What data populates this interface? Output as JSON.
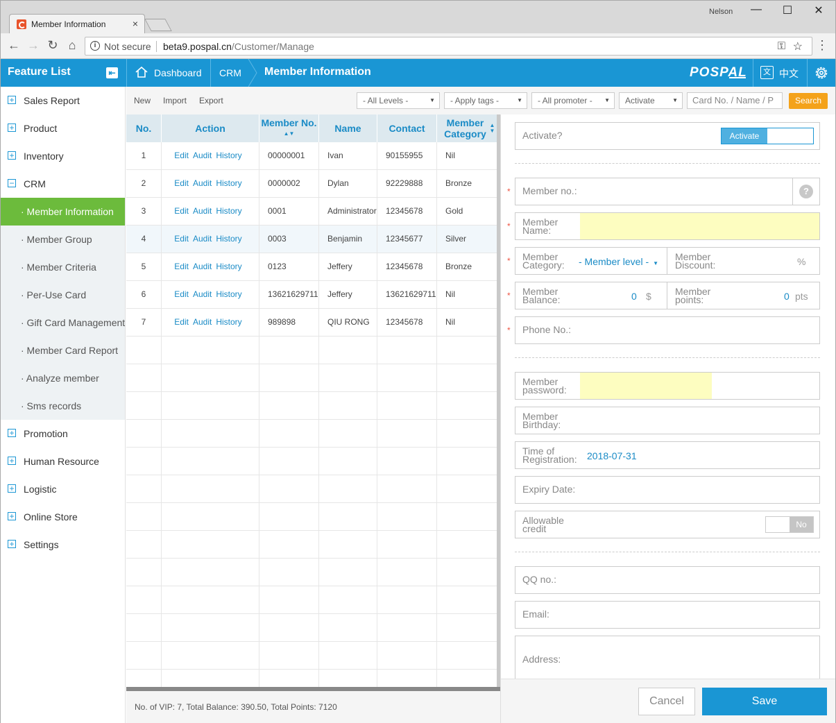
{
  "browser": {
    "tab_title": "Member Information",
    "tab_close": "×",
    "user": "Nelson",
    "win_min": "—",
    "win_max": "☐",
    "win_close": "✕",
    "back": "←",
    "forward": "→",
    "reload": "↻",
    "home": "⌂",
    "security": "Not secure",
    "url_host": "beta9.pospal.cn",
    "url_path": "/Customer/Manage",
    "key": "⚿",
    "star": "☆",
    "menu": "⋮"
  },
  "header": {
    "feature_list": "Feature List",
    "collapse": "⇤",
    "breadcrumb": [
      "Dashboard",
      "CRM"
    ],
    "current": "Member Information",
    "brand": "POSPAL",
    "lang_icon": "文",
    "lang_label": "中文",
    "accent": "#1a96d4"
  },
  "sidebar": {
    "items_top": [
      "Sales Report",
      "Product",
      "Inventory"
    ],
    "crm": "CRM",
    "crm_sub": [
      "· Member Information",
      "· Member Group",
      "· Member Criteria",
      "· Per-Use Card",
      "· Gift Card Management",
      "· Member Card Report",
      "· Analyze member",
      "· Sms records"
    ],
    "items_bottom": [
      "Promotion",
      "Human Resource",
      "Logistic",
      "Online Store",
      "Settings"
    ],
    "active_color": "#6cbb3c"
  },
  "toolbar": {
    "new": "New",
    "import": "Import",
    "export": "Export",
    "levels": "- All Levels -",
    "tags": "- Apply tags -",
    "promoter": "- All promoter -",
    "activate": "Activate",
    "search_placeholder": "Card No. / Name / P",
    "search": "Search"
  },
  "table": {
    "headers": [
      "No.",
      "Action",
      "Member No.",
      "Name",
      "Contact",
      "Member Category"
    ],
    "actions": [
      "Edit",
      "Audit",
      "History"
    ],
    "rows": [
      [
        "1",
        "00000001",
        "Ivan",
        "90155955",
        "Nil"
      ],
      [
        "2",
        "0000002",
        "Dylan",
        "92229888",
        "Bronze"
      ],
      [
        "3",
        "0001",
        "Administrator",
        "12345678",
        "Gold"
      ],
      [
        "4",
        "0003",
        "Benjamin",
        "12345677",
        "Silver"
      ],
      [
        "5",
        "0123",
        "Jeffery",
        "12345678",
        "Bronze"
      ],
      [
        "6",
        "13621629711",
        "Jeffery",
        "13621629711",
        "Nil"
      ],
      [
        "7",
        "989898",
        "QIU RONG",
        "12345678",
        "Nil"
      ]
    ],
    "footer": "No. of VIP: 7, Total Balance: 390.50, Total Points: 7120"
  },
  "form": {
    "activate_q": "Activate?",
    "activate_toggle": "Activate",
    "req": "*",
    "member_no": "Member no.:",
    "help": "?",
    "member_name": [
      "Member",
      "Name:"
    ],
    "member_category": [
      "Member",
      "Category:"
    ],
    "member_level": "- Member level -",
    "member_discount": [
      "Member",
      "Discount:"
    ],
    "discount_unit": "%",
    "member_balance": [
      "Member",
      "Balance:"
    ],
    "balance_value": "0",
    "balance_unit": "$",
    "member_points": [
      "Member",
      "points:"
    ],
    "points_value": "0",
    "points_unit": "pts",
    "phone": "Phone No.:",
    "password": [
      "Member",
      "password:"
    ],
    "birthday": [
      "Member",
      "Birthday:"
    ],
    "registration": [
      "Time of",
      "Registration:"
    ],
    "registration_date": "2018-07-31",
    "expiry": "Expiry Date:",
    "credit": [
      "Allowable",
      "credit"
    ],
    "credit_toggle": "No",
    "qq": "QQ no.:",
    "email": "Email:",
    "address": "Address:",
    "cancel": "Cancel",
    "save": "Save"
  }
}
